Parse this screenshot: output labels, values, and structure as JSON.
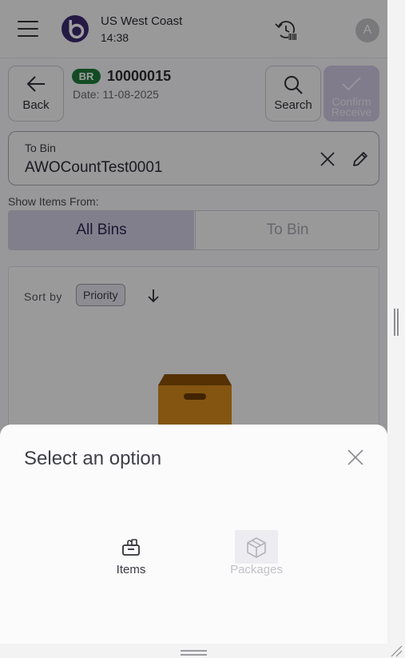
{
  "header": {
    "site_name": "US West Coast",
    "time": "14:38",
    "avatar_initial": "A"
  },
  "actions": {
    "back_label": "Back",
    "search_label": "Search",
    "confirm_label_line1": "Confirm",
    "confirm_label_line2": "Receive"
  },
  "receipt": {
    "badge": "BR",
    "number": "10000015",
    "date": "Date: 11-08-2025"
  },
  "bin_field": {
    "label": "To Bin",
    "value": "AWOCountTest0001"
  },
  "show_items": {
    "label": "Show Items From:",
    "options": [
      "All Bins",
      "To Bin"
    ],
    "selected": "All Bins"
  },
  "sort": {
    "label": "Sort by",
    "value": "Priority"
  },
  "sheet": {
    "title": "Select an option",
    "options": [
      {
        "label": "Items",
        "icon": "basket-icon",
        "enabled": true
      },
      {
        "label": "Packages",
        "icon": "package-icon",
        "enabled": false
      }
    ]
  },
  "colors": {
    "accent": "#4b2f8f",
    "badge_green": "#1f7a3a",
    "box_orange": "#c47a1a"
  }
}
